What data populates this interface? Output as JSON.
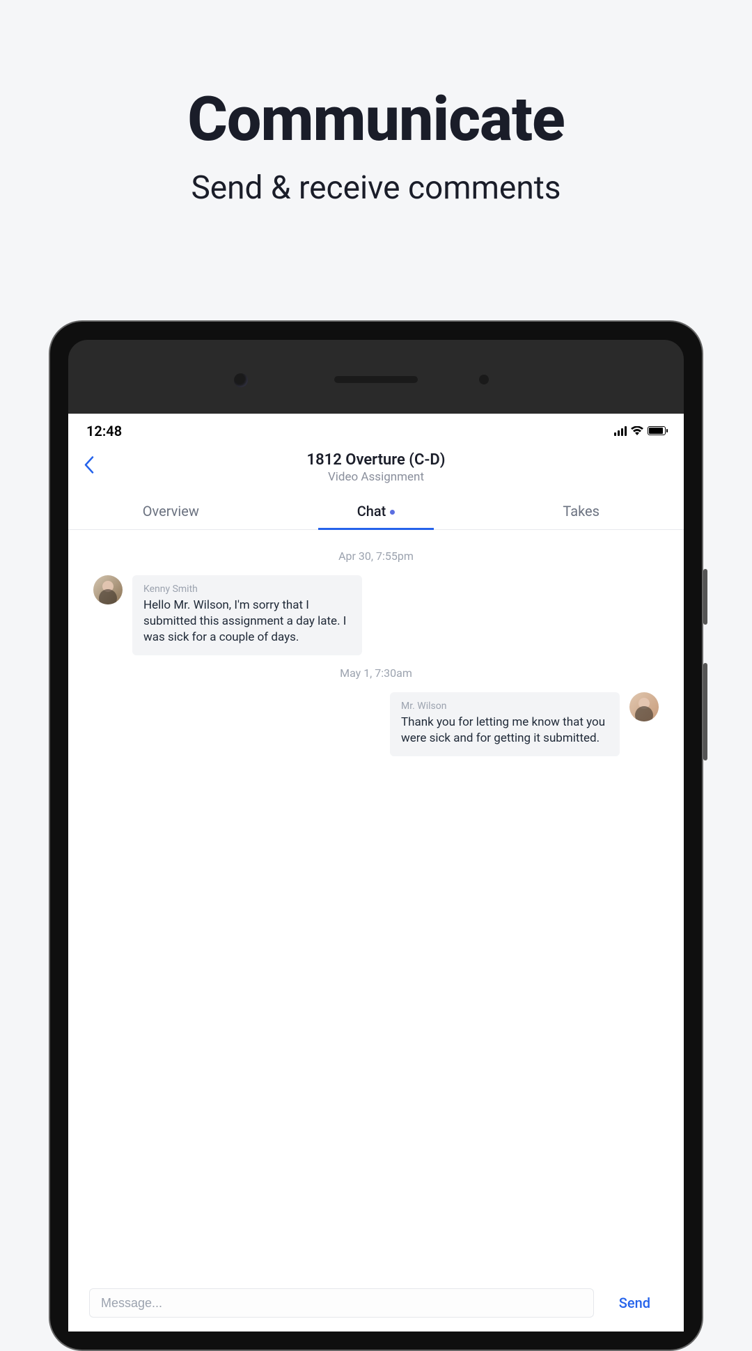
{
  "hero": {
    "title": "Communicate",
    "subtitle": "Send & receive comments"
  },
  "statusbar": {
    "time": "12:48"
  },
  "header": {
    "title": "1812 Overture (C-D)",
    "subtitle": "Video Assignment"
  },
  "tabs": {
    "overview": "Overview",
    "chat": "Chat",
    "takes": "Takes",
    "active": "chat",
    "unread": true
  },
  "messages": [
    {
      "timestamp": "Apr 30, 7:55pm",
      "side": "left",
      "sender": "Kenny Smith",
      "body": "Hello Mr. Wilson, I'm sorry that I submitted this assignment a day late. I was sick for a couple of days."
    },
    {
      "timestamp": "May 1, 7:30am",
      "side": "right",
      "sender": "Mr. Wilson",
      "body": "Thank you for letting me know that you were sick and for getting it submitted."
    }
  ],
  "composer": {
    "placeholder": "Message...",
    "send": "Send"
  }
}
